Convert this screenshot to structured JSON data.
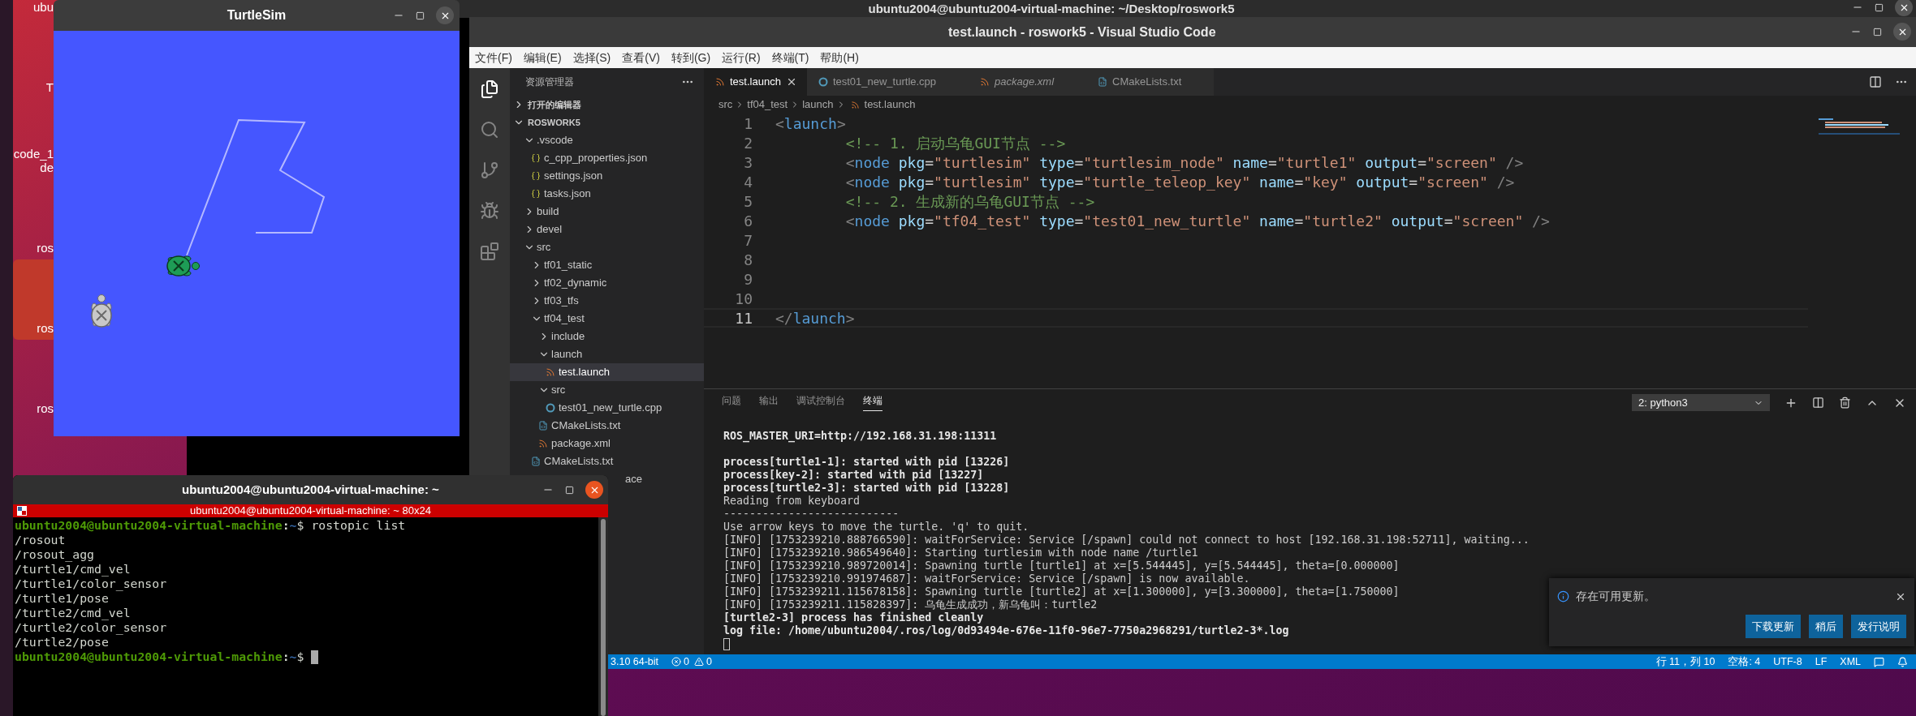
{
  "desktop": {
    "icons": [
      {
        "label": "ubu",
        "selected": false
      },
      {
        "label": "T",
        "selected": false
      },
      {
        "label": "code_1",
        "label_line_2": "de",
        "selected": false
      },
      {
        "label": "ros",
        "selected": false
      },
      {
        "label": "ros",
        "selected": true
      },
      {
        "label": "ros",
        "selected": false
      }
    ]
  },
  "background_terminal": {
    "title": "ubuntu2004@ubuntu2004-virtual-machine: ~/Desktop/roswork5"
  },
  "turtlesim": {
    "title": "TurtleSim"
  },
  "vscode": {
    "title": "test.launch - roswork5 - Visual Studio Code",
    "menu": [
      "文件(F)",
      "编辑(E)",
      "选择(S)",
      "查看(V)",
      "转到(G)",
      "运行(R)",
      "终端(T)",
      "帮助(H)"
    ],
    "explorer": {
      "title": "资源管理器",
      "open_editors": "打开的编辑器",
      "root": "ROSWORK5",
      "tree": [
        {
          "label": ".vscode",
          "kind": "folder",
          "expanded": true,
          "children": [
            {
              "label": "c_cpp_properties.json",
              "kind": "json",
              "selected": false
            },
            {
              "label": "settings.json",
              "kind": "json",
              "selected": false
            },
            {
              "label": "tasks.json",
              "kind": "json",
              "selected": false
            }
          ]
        },
        {
          "label": "build",
          "kind": "folder",
          "expanded": false
        },
        {
          "label": "devel",
          "kind": "folder",
          "expanded": false
        },
        {
          "label": "src",
          "kind": "folder",
          "expanded": true,
          "children": [
            {
              "label": "tf01_static",
              "kind": "folder",
              "expanded": false
            },
            {
              "label": "tf02_dynamic",
              "kind": "folder",
              "expanded": false
            },
            {
              "label": "tf03_tfs",
              "kind": "folder",
              "expanded": false
            },
            {
              "label": "tf04_test",
              "kind": "folder",
              "expanded": true,
              "children": [
                {
                  "label": "include",
                  "kind": "folder",
                  "expanded": false
                },
                {
                  "label": "launch",
                  "kind": "folder",
                  "expanded": true,
                  "children": [
                    {
                      "label": "test.launch",
                      "kind": "xml",
                      "selected": true
                    }
                  ]
                },
                {
                  "label": "src",
                  "kind": "folder",
                  "expanded": true,
                  "children": [
                    {
                      "label": "test01_new_turtle.cpp",
                      "kind": "cpp",
                      "selected": false
                    }
                  ]
                },
                {
                  "label": "CMakeLists.txt",
                  "kind": "cmake",
                  "selected": false
                },
                {
                  "label": "package.xml",
                  "kind": "xml",
                  "selected": false
                }
              ]
            },
            {
              "label": "CMakeLists.txt",
              "kind": "cmake",
              "selected": false
            }
          ]
        },
        {
          "label": "ace",
          "kind": "partial",
          "selected": false
        }
      ]
    },
    "tabs": [
      {
        "label": "test.launch",
        "kind": "xml",
        "italic": false,
        "selected": true
      },
      {
        "label": "test01_new_turtle.cpp",
        "kind": "cpp",
        "italic": false,
        "selected": false
      },
      {
        "label": "package.xml",
        "kind": "xml",
        "italic": true,
        "selected": false
      },
      {
        "label": "CMakeLists.txt",
        "kind": "cmake",
        "italic": false,
        "selected": false
      }
    ],
    "breadcrumb": [
      "src",
      "tf04_test",
      "launch",
      "test.launch"
    ],
    "code": [
      {
        "number": "1",
        "current": false,
        "tokens": [
          {
            "kind": "punct",
            "text": "<"
          },
          {
            "kind": "tag",
            "text": "launch"
          },
          {
            "kind": "punct",
            "text": ">"
          }
        ]
      },
      {
        "number": "2",
        "current": false,
        "tokens": [
          {
            "kind": "comment",
            "text": "\t\t<!-- 1. 启动乌龟GUI节点 -->"
          }
        ]
      },
      {
        "number": "3",
        "current": false,
        "tokens": [
          {
            "kind": "punct",
            "text": "\t\t<"
          },
          {
            "kind": "tag",
            "text": "node"
          },
          {
            "kind": "attr",
            "text": " pkg"
          },
          {
            "kind": "op",
            "text": "="
          },
          {
            "kind": "string",
            "text": "\"turtlesim\""
          },
          {
            "kind": "attr",
            "text": " type"
          },
          {
            "kind": "op",
            "text": "="
          },
          {
            "kind": "string",
            "text": "\"turtlesim_node\""
          },
          {
            "kind": "attr",
            "text": " name"
          },
          {
            "kind": "op",
            "text": "="
          },
          {
            "kind": "string",
            "text": "\"turtle1\""
          },
          {
            "kind": "attr",
            "text": " output"
          },
          {
            "kind": "op",
            "text": "="
          },
          {
            "kind": "string",
            "text": "\"screen\""
          },
          {
            "kind": "punct",
            "text": " />"
          }
        ]
      },
      {
        "number": "4",
        "current": false,
        "tokens": [
          {
            "kind": "punct",
            "text": "\t\t<"
          },
          {
            "kind": "tag",
            "text": "node"
          },
          {
            "kind": "attr",
            "text": " pkg"
          },
          {
            "kind": "op",
            "text": "="
          },
          {
            "kind": "string",
            "text": "\"turtlesim\""
          },
          {
            "kind": "attr",
            "text": " type"
          },
          {
            "kind": "op",
            "text": "="
          },
          {
            "kind": "string",
            "text": "\"turtle_teleop_key\""
          },
          {
            "kind": "attr",
            "text": " name"
          },
          {
            "kind": "op",
            "text": "="
          },
          {
            "kind": "string",
            "text": "\"key\""
          },
          {
            "kind": "attr",
            "text": " output"
          },
          {
            "kind": "op",
            "text": "="
          },
          {
            "kind": "string",
            "text": "\"screen\""
          },
          {
            "kind": "punct",
            "text": " />"
          }
        ]
      },
      {
        "number": "5",
        "current": false,
        "tokens": [
          {
            "kind": "comment",
            "text": "\t\t<!-- 2. 生成新的乌龟GUI节点 -->"
          }
        ]
      },
      {
        "number": "6",
        "current": false,
        "tokens": [
          {
            "kind": "punct",
            "text": "\t\t<"
          },
          {
            "kind": "tag",
            "text": "node"
          },
          {
            "kind": "attr",
            "text": " pkg"
          },
          {
            "kind": "op",
            "text": "="
          },
          {
            "kind": "string",
            "text": "\"tf04_test\""
          },
          {
            "kind": "attr",
            "text": " type"
          },
          {
            "kind": "op",
            "text": "="
          },
          {
            "kind": "string",
            "text": "\"test01_new_turtle\""
          },
          {
            "kind": "attr",
            "text": " name"
          },
          {
            "kind": "op",
            "text": "="
          },
          {
            "kind": "string",
            "text": "\"turtle2\""
          },
          {
            "kind": "attr",
            "text": " output"
          },
          {
            "kind": "op",
            "text": "="
          },
          {
            "kind": "string",
            "text": "\"screen\""
          },
          {
            "kind": "punct",
            "text": " />"
          }
        ]
      },
      {
        "number": "7",
        "current": false
      },
      {
        "number": "8",
        "current": false
      },
      {
        "number": "9",
        "current": false
      },
      {
        "number": "10",
        "current": false
      },
      {
        "number": "11",
        "current": true,
        "tokens": [
          {
            "kind": "punct",
            "text": "</"
          },
          {
            "kind": "tag",
            "text": "launch"
          },
          {
            "kind": "punct",
            "text": ">"
          }
        ]
      }
    ],
    "panel": {
      "tabs": [
        {
          "label": "问题",
          "selected": false
        },
        {
          "label": "输出",
          "selected": false
        },
        {
          "label": "调试控制台",
          "selected": false
        },
        {
          "label": "终端",
          "selected": true
        }
      ],
      "dropdown": "2: python3",
      "blocks": [
        [
          {
            "text": "ROS_MASTER_URI=http://192.168.31.198:11311",
            "bold": true
          }
        ],
        [
          {
            "text": "process[turtle1-1]: started with pid [13226]",
            "bold": true
          },
          {
            "text": "process[key-2]: started with pid [13227]",
            "bold": true
          },
          {
            "text": "process[turtle2-3]: started with pid [13228]",
            "bold": true
          },
          {
            "text": "Reading from keyboard",
            "bold": false
          },
          {
            "text": "---------------------------",
            "bold": false
          },
          {
            "text": "Use arrow keys to move the turtle. 'q' to quit.",
            "bold": false
          },
          {
            "text": "[INFO] [1753239210.888766590]: waitForService: Service [/spawn] could not connect to host [192.168.31.198:52711], waiting...",
            "bold": false
          },
          {
            "text": "[INFO] [1753239210.986549640]: Starting turtlesim with node name /turtle1",
            "bold": false
          },
          {
            "text": "[INFO] [1753239210.989720014]: Spawning turtle [turtle1] at x=[5.544445], y=[5.544445], theta=[0.000000]",
            "bold": false
          },
          {
            "text": "[INFO] [1753239210.991974687]: waitForService: Service [/spawn] is now available.",
            "bold": false
          },
          {
            "text": "[INFO] [1753239211.115678158]: Spawning turtle [turtle2] at x=[1.300000], y=[3.300000], theta=[1.750000]",
            "bold": false
          },
          {
            "text": "[INFO] [1753239211.115828397]: 乌龟生成成功，新乌龟叫：turtle2",
            "bold": false
          },
          {
            "text": "[turtle2-3] process has finished cleanly",
            "bold": true
          },
          {
            "text": "log file: /home/ubuntu2004/.ros/log/0d93494e-676e-11f0-96e7-7750a2968291/turtle2-3*.log",
            "bold": true
          }
        ]
      ]
    },
    "status_bar": {
      "interpreter": "3.10 64-bit",
      "errors": "0",
      "warnings": "0",
      "right": [
        "行 11，列 10",
        "空格: 4",
        "UTF-8",
        "LF",
        "XML"
      ]
    },
    "notification": {
      "message": "存在可用更新。",
      "buttons": [
        "下载更新",
        "稍后",
        "发行说明"
      ]
    }
  },
  "terminal": {
    "title": "ubuntu2004@ubuntu2004-virtual-machine: ~",
    "tab_title": "ubuntu2004@ubuntu2004-virtual-machine: ~ 80x24",
    "lines": [
      {
        "kind": "prompt",
        "user": "ubuntu2004@ubuntu2004-virtual-machine",
        "separator": ":",
        "path": "~",
        "sigil": "$",
        "command": "rostopic list",
        "cursor": false
      },
      {
        "kind": "output",
        "text": "/rosout"
      },
      {
        "kind": "output",
        "text": "/rosout_agg"
      },
      {
        "kind": "output",
        "text": "/turtle1/cmd_vel"
      },
      {
        "kind": "output",
        "text": "/turtle1/color_sensor"
      },
      {
        "kind": "output",
        "text": "/turtle1/pose"
      },
      {
        "kind": "output",
        "text": "/turtle2/cmd_vel"
      },
      {
        "kind": "output",
        "text": "/turtle2/color_sensor"
      },
      {
        "kind": "output",
        "text": "/turtle2/pose"
      },
      {
        "kind": "prompt",
        "user": "ubuntu2004@ubuntu2004-virtual-machine",
        "separator": ":",
        "path": "~",
        "sigil": "$",
        "cursor": true
      }
    ]
  }
}
